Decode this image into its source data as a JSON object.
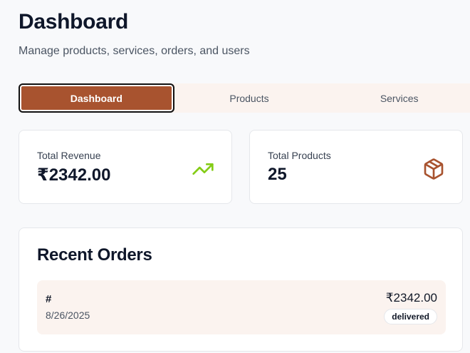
{
  "header": {
    "title": "Dashboard",
    "subtitle": "Manage products, services, orders, and users"
  },
  "tabs": [
    {
      "label": "Dashboard",
      "active": true
    },
    {
      "label": "Products",
      "active": false
    },
    {
      "label": "Services",
      "active": false
    }
  ],
  "stats": {
    "revenue": {
      "label": "Total Revenue",
      "value": "₹2342.00",
      "icon": "trending-up-icon",
      "icon_color": "#84cc16"
    },
    "products": {
      "label": "Total Products",
      "value": "25",
      "icon": "package-icon",
      "icon_color": "#a8532f"
    }
  },
  "orders": {
    "title": "Recent Orders",
    "items": [
      {
        "id": "#",
        "date": "8/26/2025",
        "amount": "₹2342.00",
        "status": "delivered"
      }
    ]
  },
  "colors": {
    "accent": "#a8532f",
    "accent_light": "#fbf3ef",
    "success": "#84cc16"
  }
}
